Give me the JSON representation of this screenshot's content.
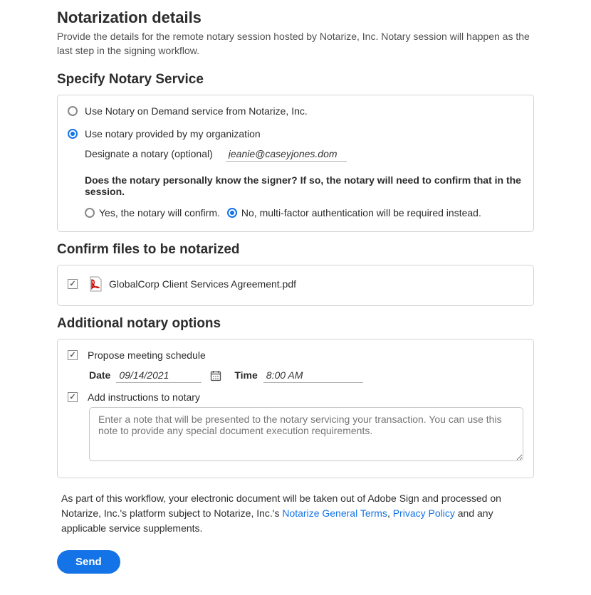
{
  "header": {
    "title": "Notarization details",
    "subtitle": "Provide the details for the remote notary session hosted by Notarize, Inc. Notary session will happen as the last step in the signing workflow."
  },
  "notaryService": {
    "heading": "Specify Notary Service",
    "option1": "Use Notary on Demand service from Notarize, Inc.",
    "option2": "Use notary provided by my organization",
    "designateLabel": "Designate a notary (optional)",
    "designateValue": "jeanie@caseyjones.dom",
    "question": "Does the notary personally know the signer? If so, the notary will need to confirm that in the session.",
    "yes": "Yes, the notary will confirm.",
    "no": "No, multi-factor authentication will be required instead."
  },
  "files": {
    "heading": "Confirm files to be notarized",
    "items": [
      {
        "name": "GlobalCorp Client Services Agreement.pdf"
      }
    ]
  },
  "options": {
    "heading": "Additional notary options",
    "proposeLabel": "Propose meeting schedule",
    "dateLabel": "Date",
    "dateValue": "09/14/2021",
    "timeLabel": "Time",
    "timeValue": "8:00 AM",
    "instructionsLabel": "Add instructions to notary",
    "notesPlaceholder": "Enter a note that will be presented to the notary servicing your transaction. You can use this note to provide any special document execution requirements."
  },
  "legal": {
    "pre": "As part of this workflow, your electronic document will be taken out of Adobe Sign and processed on Notarize, Inc.'s platform subject to Notarize, Inc.'s ",
    "link1": "Notarize General Terms",
    "sep": ", ",
    "link2": "Privacy Policy",
    "post": " and any applicable service supplements."
  },
  "actions": {
    "send": "Send"
  }
}
